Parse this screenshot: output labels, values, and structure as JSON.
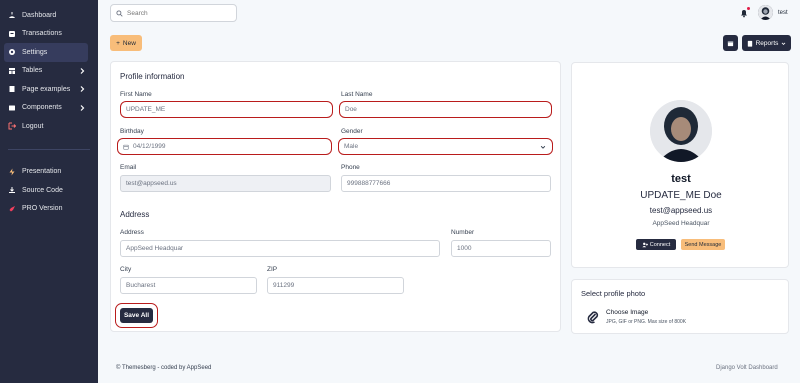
{
  "sidebar": {
    "items": [
      {
        "label": "Dashboard",
        "icon": "dashboard-icon"
      },
      {
        "label": "Transactions",
        "icon": "transactions-icon"
      },
      {
        "label": "Settings",
        "icon": "settings-gear-icon",
        "active": true
      },
      {
        "label": "Tables",
        "icon": "tables-icon",
        "chevron": true
      },
      {
        "label": "Page examples",
        "icon": "page-examples-icon",
        "chevron": true
      },
      {
        "label": "Components",
        "icon": "components-icon",
        "chevron": true
      },
      {
        "label": "Logout",
        "icon": "logout-icon"
      }
    ],
    "secondary": [
      {
        "label": "Presentation",
        "icon": "lightning-icon"
      },
      {
        "label": "Source Code",
        "icon": "download-icon"
      },
      {
        "label": "PRO Version",
        "icon": "rocket-icon"
      }
    ]
  },
  "topbar": {
    "search_placeholder": "Search",
    "user_name": "test",
    "new_label": "New",
    "reports_label": "Reports"
  },
  "profile_info": {
    "title": "Profile information",
    "first_name_label": "First Name",
    "first_name_value": "UPDATE_ME",
    "last_name_label": "Last Name",
    "last_name_value": "Doe",
    "birthday_label": "Birthday",
    "birthday_value": "04/12/1999",
    "gender_label": "Gender",
    "gender_value": "Male",
    "email_label": "Email",
    "email_value": "test@appseed.us",
    "phone_label": "Phone",
    "phone_value": "999888777666",
    "address_title": "Address",
    "address_label": "Address",
    "address_value": "AppSeed Headquar",
    "number_label": "Number",
    "number_value": "1000",
    "city_label": "City",
    "city_value": "Bucharest",
    "zip_label": "ZIP",
    "zip_value": "911299",
    "save_label": "Save All"
  },
  "profile_card": {
    "username": "test",
    "full_name": "UPDATE_ME Doe",
    "email": "test@appseed.us",
    "address": "AppSeed Headquar",
    "connect_label": "Connect",
    "message_label": "Send Message"
  },
  "photo_card": {
    "title": "Select profile photo",
    "choose_label": "Choose Image",
    "hint": "JPG, GIF or PNG. Max size of 800K"
  },
  "footer": {
    "left": "© Themesberg - coded by AppSeed",
    "right": "Django Volt Dashboard"
  },
  "colors": {
    "sidebar_bg": "#262b40",
    "accent_orange": "#f8bd7a",
    "highlight_red": "#b91c1c"
  }
}
